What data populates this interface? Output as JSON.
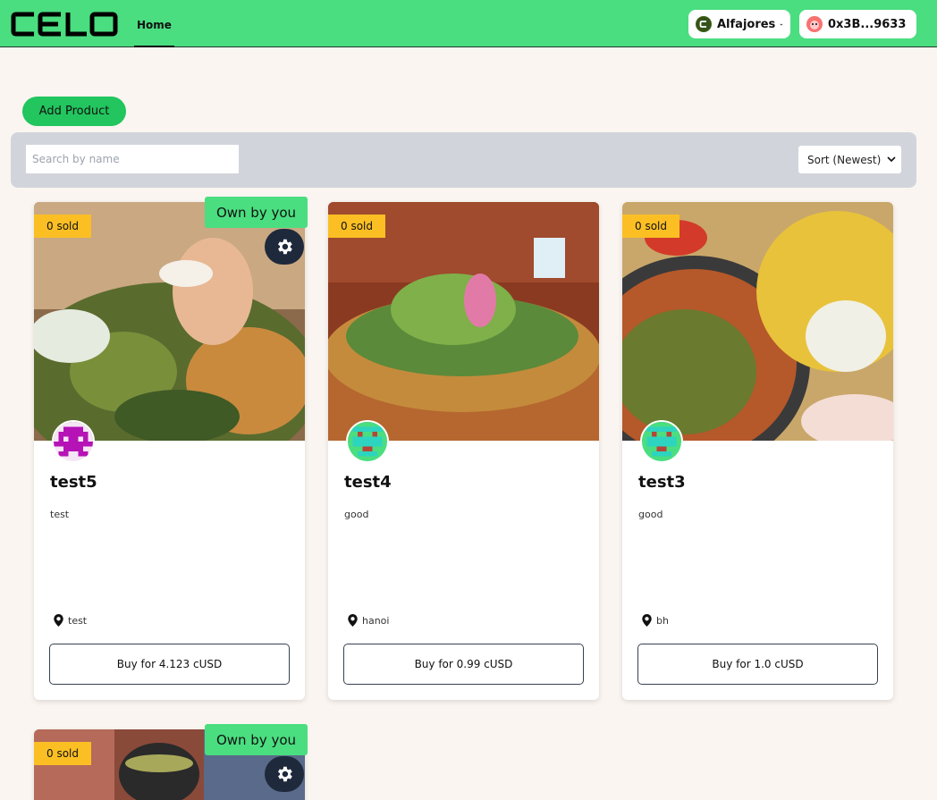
{
  "header": {
    "logo_text": "Celo",
    "nav_home": "Home",
    "network": {
      "label": "Alfajores",
      "icon": "celo-network-icon"
    },
    "account": {
      "label": "0x3B...9633",
      "icon": "avatar-icon"
    }
  },
  "actions": {
    "add_product": "Add Product"
  },
  "toolbar": {
    "search_placeholder": "Search by name",
    "sort_selected": "Sort (Newest)"
  },
  "products": [
    {
      "sold": "0 sold",
      "own_label": "Own by you",
      "name": "test5",
      "description": "test",
      "location": "test",
      "buy": "Buy for 4.123 cUSD",
      "owned": true
    },
    {
      "sold": "0 sold",
      "name": "test4",
      "description": "good",
      "location": "hanoi",
      "buy": "Buy for 0.99 cUSD",
      "owned": false
    },
    {
      "sold": "0 sold",
      "name": "test3",
      "description": "good",
      "location": "bh",
      "buy": "Buy for 1.0 cUSD",
      "owned": false
    },
    {
      "sold": "0 sold",
      "own_label": "Own by you",
      "owned": true
    }
  ],
  "colors": {
    "header": "#4ade80",
    "button": "#22c55e",
    "sold_badge": "#fbbf24",
    "toolbar": "#d1d5db"
  }
}
